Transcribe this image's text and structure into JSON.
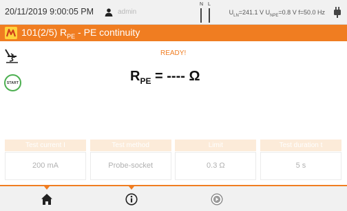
{
  "status_bar": {
    "datetime": "20/11/2019 9:00:05 PM",
    "user": "admin",
    "user_icon": "user-icon",
    "probe_labels": {
      "n": "N",
      "l": "L"
    },
    "measurements": {
      "uln_label": "U",
      "uln_sub": "LN",
      "uln_value": "=241.1 V",
      "upe_label": "U",
      "upe_sub": "NPE",
      "upe_value": "=0.8 V",
      "freq": "f=50.0 Hz"
    },
    "plug_icon": "plug-icon"
  },
  "title_bar": {
    "icon": "measurement-icon",
    "prefix": "101(2/5) R",
    "subscript": "PE",
    "suffix": " - PE continuity"
  },
  "measurement": {
    "status": "READY!",
    "probe_icon": "probe-setting-icon",
    "start_label": "START",
    "result_symbol": "R",
    "result_subscript": "PE",
    "result_value": " = ---- Ω"
  },
  "parameters": [
    {
      "header": "Test current I",
      "value": "200 mA"
    },
    {
      "header": "Test method",
      "value": "Probe-socket"
    },
    {
      "header": "Limit",
      "value": "0.3 Ω"
    },
    {
      "header": "Test duration t",
      "value": "5 s"
    }
  ],
  "bottom_nav": {
    "items": [
      "home-icon",
      "info-icon",
      "next-icon"
    ]
  },
  "colors": {
    "accent": "#f07d21",
    "start_ring": "#4caf50",
    "param_header_bg": "#fcebd9"
  }
}
